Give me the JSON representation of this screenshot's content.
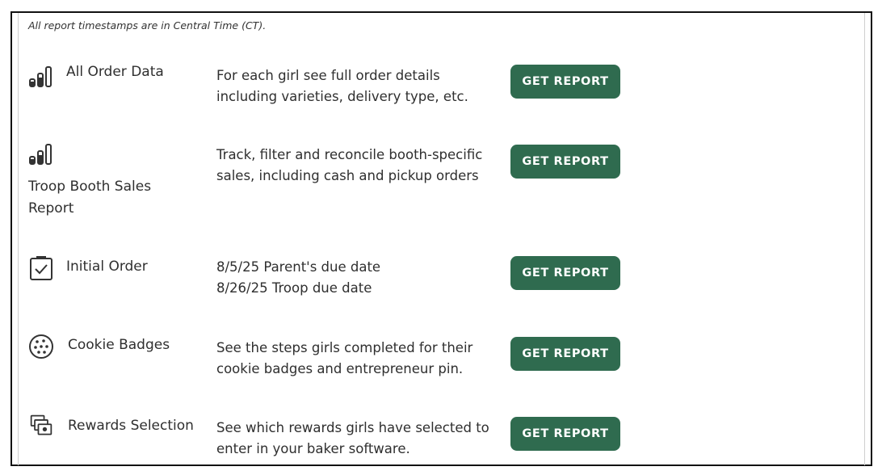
{
  "note": "All report timestamps are in Central Time (CT).",
  "reports": [
    {
      "icon": "bar-chart-icon",
      "title": "All Order Data",
      "desc_lines": [
        "For each girl see full order details",
        "including varieties, delivery type, etc."
      ],
      "button": "GET REPORT"
    },
    {
      "icon": "bar-chart-icon",
      "title_lines": [
        "Troop Booth Sales",
        "Report"
      ],
      "desc_lines": [
        "Track, filter and reconcile booth-specific",
        "sales, including cash and pickup orders"
      ],
      "button": "GET REPORT"
    },
    {
      "icon": "clipboard-check-icon",
      "title": "Initial Order",
      "desc_lines": [
        "8/5/25 Parent's due date",
        "8/26/25 Troop due date"
      ],
      "button": "GET REPORT"
    },
    {
      "icon": "cookie-icon",
      "title": "Cookie Badges",
      "desc_lines": [
        "See the steps girls completed for their",
        "cookie badges and entrepreneur pin."
      ],
      "button": "GET REPORT"
    },
    {
      "icon": "rewards-stack-icon",
      "title": "Rewards Selection",
      "desc_lines": [
        "See which rewards girls have selected to",
        "enter in your baker software."
      ],
      "button": "GET REPORT"
    }
  ]
}
